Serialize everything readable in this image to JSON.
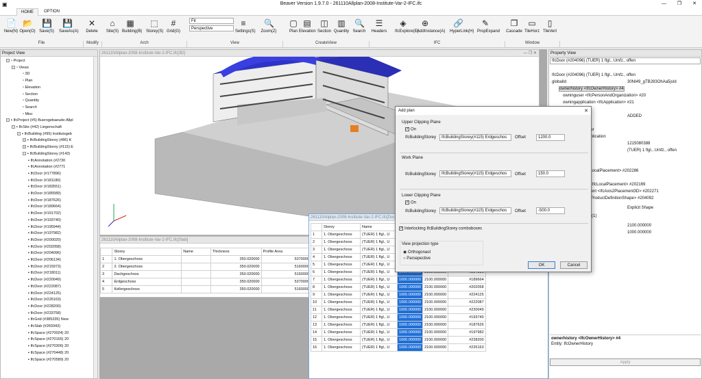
{
  "window": {
    "title": "Beaver Version 1.9.7.0 - 261110Allplan-2008-Institute-Var-2-IFC.ifc"
  },
  "tabs": [
    "HOME",
    "OPTION"
  ],
  "ribbon": {
    "buttons": [
      {
        "label": "New(N)",
        "icon": "📄"
      },
      {
        "label": "Open(O)",
        "icon": "📂"
      },
      {
        "label": "Save(S)",
        "icon": "💾"
      },
      {
        "label": "SaveAs(A)",
        "icon": "💾"
      },
      {
        "label": "Delete",
        "icon": "✕"
      },
      {
        "label": "Site(S)",
        "icon": "⌂"
      },
      {
        "label": "Building(B)",
        "icon": "▦"
      },
      {
        "label": "Storey(S)",
        "icon": "⬚"
      },
      {
        "label": "Grid(G)",
        "icon": "#"
      },
      {
        "label": "Settings(S)",
        "icon": "≡"
      },
      {
        "label": "Zoom(Z)",
        "icon": "🔍"
      },
      {
        "label": "Plan",
        "icon": "▢"
      },
      {
        "label": "Elevation",
        "icon": "▤"
      },
      {
        "label": "Section",
        "icon": "◫"
      },
      {
        "label": "Quantity",
        "icon": "▥"
      },
      {
        "label": "Search",
        "icon": "🔍"
      },
      {
        "label": "Headers",
        "icon": "☰"
      },
      {
        "label": "IfcExplore(E)",
        "icon": "◈"
      },
      {
        "label": "AddInstance(A)",
        "icon": "⊕"
      },
      {
        "label": "HyperLink(H)",
        "icon": "🔗"
      },
      {
        "label": "PropExpand",
        "icon": "✎"
      },
      {
        "label": "Cascade",
        "icon": "❐"
      },
      {
        "label": "TileHorz",
        "icon": "▭"
      },
      {
        "label": "TileVert",
        "icon": "▯"
      }
    ],
    "groups": [
      "File",
      "Modify",
      "Arch",
      "View",
      "CreateView",
      "IFC",
      "Window"
    ],
    "fit_value": "Fit",
    "projection_value": "Perspective"
  },
  "project_view": {
    "title": "Project View",
    "items": [
      "Project",
      "Views",
      "3D",
      "Plan",
      "Elevation",
      "Section",
      "Quantity",
      "Search",
      "Misc",
      "IfcProject (#5) Buerogebaeude-Allpl",
      "IfcSite (#42) Liegenschaft",
      "IfcBuilding (#95) Institutsgeb",
      "IfcBuildingStorey (#86) K",
      "IfcBuildingStorey (#115) E",
      "IfcBuildingStorey (#143)",
      "IfcAnnotation (#2730",
      "IfcAnnotation (#2771",
      "IfcDoor (#177896)",
      "IfcDoor (#181180)",
      "IfcDoor (#183551)",
      "IfcDoor (#185589)",
      "IfcDoor (#187626)",
      "IfcDoor (#189664)",
      "IfcDoor (#191702)",
      "IfcDoor (#193740)",
      "IfcDoor (#195944)",
      "IfcDoor (#197982)",
      "IfcDoor (#200020)",
      "IfcDoor (#202058)",
      "IfcDoor (#204096)",
      "IfcDoor (#206134)",
      "IfcDoor (#215973)",
      "IfcDoor (#218011)",
      "IfcDoor (#220049)",
      "IfcDoor (#222087)",
      "IfcDoor (#224125)",
      "IfcDoor (#226163)",
      "IfcDoor (#228200)",
      "IfcDoor (#233758)",
      "IfcGrid (#385335) New",
      "IfcSlab (#269343)",
      "IfcSpace (#270024) 20",
      "IfcSpace (#270165) 20",
      "IfcSpace (#270306) 20",
      "IfcSpace (#270448) 20",
      "IfcSpace (#270589) 20"
    ]
  },
  "view3d": {
    "title": "261110Allplan-2008-Institute-Var-2-IFC.ifc[3D]"
  },
  "slab_window": {
    "title": "261110Allplan-2008-Institute-Var-2-IFC.ifc[Slab]",
    "headers": [
      "",
      "Storey",
      "Name",
      "Thickness",
      "Profile Area"
    ],
    "rows": [
      [
        "1",
        "1. Obergeschoss",
        "",
        "350.020000",
        "5370000"
      ],
      [
        "2",
        "2. Obergeschoss",
        "",
        "350.020000",
        "5160000"
      ],
      [
        "3",
        "Dachgeschoss",
        "",
        "350.020000",
        "5160000"
      ],
      [
        "4",
        "Erdgeschoss",
        "",
        "350.020000",
        "5370000"
      ],
      [
        "5",
        "Kellergeschoss",
        "",
        "350.020000",
        "5160000"
      ]
    ]
  },
  "door_window": {
    "title": "261110Allplan-2008-Institute-Var-2-IFC.ifc[Door]",
    "headers": [
      "",
      "Storey",
      "Name"
    ],
    "rows": [
      [
        "1",
        "1. Obergeschoss",
        "(TUER) 1 flgl., U",
        "",
        "",
        ""
      ],
      [
        "2",
        "1. Obergeschoss",
        "(TUER) 1 flgl., U",
        "",
        "",
        ""
      ],
      [
        "3",
        "1. Obergeschoss",
        "(TUER) 1 flgl., U",
        "",
        "",
        ""
      ],
      [
        "4",
        "1. Obergeschoss",
        "(TUER) 1 flgl., U",
        "",
        "",
        ""
      ],
      [
        "5",
        "1. Obergeschoss",
        "(TUER) 1 flgl., U",
        "",
        "",
        ""
      ],
      [
        "6",
        "1. Obergeschoss",
        "(TUER) 1 flgl., U",
        "1000.000000",
        "2100.000000",
        "#204096"
      ],
      [
        "7",
        "1. Obergeschoss",
        "(TUER) 1 flgl., U",
        "1000.000000",
        "2100.000000",
        "#189664"
      ],
      [
        "8",
        "1. Obergeschoss",
        "(TUER) 1 flgl., U",
        "1000.000000",
        "2100.000000",
        "#202058"
      ],
      [
        "9",
        "1. Obergeschoss",
        "(TUER) 1 flgl., U",
        "1000.000000",
        "2100.000000",
        "#224125"
      ],
      [
        "10",
        "1. Obergeschoss",
        "(TUER) 1 flgl., U",
        "1000.000000",
        "2100.000000",
        "#222087"
      ],
      [
        "11",
        "1. Obergeschoss",
        "(TUER) 1 flgl., U",
        "1000.000000",
        "2100.000000",
        "#220049"
      ],
      [
        "12",
        "1. Obergeschoss",
        "(TUER) 1 flgl., U",
        "1000.000000",
        "2100.000000",
        "#193740"
      ],
      [
        "13",
        "1. Obergeschoss",
        "(TUER) 1 flgl., U",
        "1000.000000",
        "2100.000000",
        "#187626"
      ],
      [
        "14",
        "1. Obergeschoss",
        "(TUER) 1 flgl., U",
        "1000.000000",
        "2100.000000",
        "#197982"
      ],
      [
        "15",
        "1. Obergeschoss",
        "(TUER) 1 flgl., U",
        "1000.000000",
        "2100.000000",
        "#228200"
      ],
      [
        "16",
        "1. Obergeschoss",
        "(TUER) 1 flgl., U",
        "1000.000000",
        "2100.000000",
        "#226163"
      ]
    ]
  },
  "property_view": {
    "title": "Property View",
    "selector": "IfcDoor (#204096)  (TUER) 1 flgl., Umfz., offen",
    "rows": [
      {
        "text": "IfcDoor (#204096)  (TUER) 1 flgl., Umfz., offen",
        "value": ""
      },
      {
        "text": "globalId",
        "value": "30NI49_gTB283OhAa5jsId"
      },
      {
        "text": "ownerhistory <IfcOwnerHistory> #4",
        "value": ""
      },
      {
        "text": "owninguser <IfcPersonAndOrganization> #20",
        "value": ""
      },
      {
        "text": "owningapplication <IfcApplication> #21",
        "value": ""
      },
      {
        "text": "",
        "value": "ADDED"
      },
      {
        "text": "ate",
        "value": ""
      },
      {
        "text": "inguser",
        "value": ""
      },
      {
        "text": "ingapplication",
        "value": ""
      },
      {
        "text": "",
        "value": "1215080388"
      },
      {
        "text": "",
        "value": "(TUER) 1 flgl., Umfz., offen"
      },
      {
        "text": "t <IfcLocalPlacement> #202286",
        "value": ""
      },
      {
        "text": "relto <IfcLocalPlacement> #202169",
        "value": ""
      },
      {
        "text": "acement <IfcAxis2Placement3D> #202271",
        "value": ""
      },
      {
        "text": "n <IfcProductDefinitionShape> #204092",
        "value": ""
      },
      {
        "text": "",
        "value": "Explicit Shape"
      },
      {
        "text": "ations(1)",
        "value": ""
      },
      {
        "text": "",
        "value": "2100.000000"
      },
      {
        "text": "",
        "value": "1000.000000"
      }
    ],
    "desc_title": "ownerhistory <IfcOwnerHistory> #4",
    "desc_text": "Entity: IfcOwnerHistory",
    "apply": "Apply"
  },
  "dialog": {
    "title": "Add plan",
    "upper": {
      "label": "Upper Clipping Plane",
      "on": "On",
      "storey_label": "IfcBuildingStorey",
      "storey": "IfcBuildingStorey(#115) Erdgeschos",
      "offset_label": "Offset",
      "offset": "1200.0"
    },
    "work": {
      "label": "Work Plane",
      "storey_label": "IfcBuildingStorey",
      "storey": "IfcBuildingStorey(#115) Erdgeschos",
      "offset_label": "Offset",
      "offset": "150.0"
    },
    "lower": {
      "label": "Lower Clipping Plane",
      "on": "On",
      "storey_label": "IfcBuildingStorey",
      "storey": "IfcBuildingStorey(#115) Erdgeschos",
      "offset_label": "Offset",
      "offset": "-500.0"
    },
    "interlock": "Interlocking IfcBuildingStorey comboboxes",
    "projection": {
      "label": "View projection type",
      "opt1": "Orthogonaol",
      "opt2": "Parsepective"
    },
    "ok": "OK",
    "cancel": "Cancel"
  }
}
